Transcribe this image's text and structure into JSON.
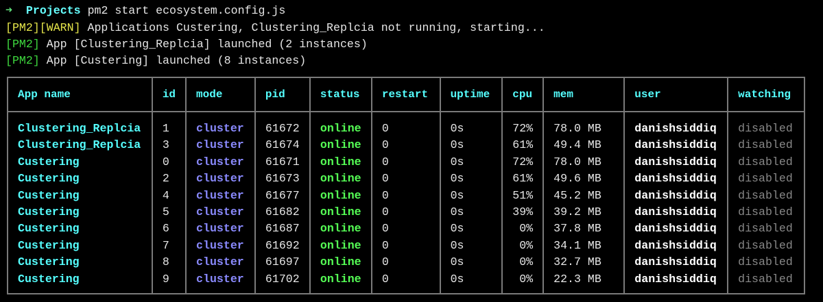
{
  "prompt": {
    "arrow": "➜",
    "dir": "Projects",
    "command": "pm2 start ecosystem.config.js"
  },
  "output": [
    {
      "tag": "[PM2][WARN]",
      "text": " Applications Custering, Clustering_Replcia not running, starting...",
      "color": "#e5e54a"
    },
    {
      "tag": "[PM2]",
      "text": " App [Clustering_Replcia] launched (2 instances)",
      "color": "#3ed83e"
    },
    {
      "tag": "[PM2]",
      "text": " App [Custering] launched (8 instances)",
      "color": "#3ed83e"
    }
  ],
  "table": {
    "headers": [
      "App name",
      "id",
      "mode",
      "pid",
      "status",
      "restart",
      "uptime",
      "cpu",
      "mem",
      "user",
      "watching"
    ],
    "rows": [
      [
        "Clustering_Replcia",
        "1",
        "cluster",
        "61672",
        "online",
        "0",
        "0s",
        "72%",
        "78.0 MB",
        "danishsiddiq",
        "disabled"
      ],
      [
        "Clustering_Replcia",
        "3",
        "cluster",
        "61674",
        "online",
        "0",
        "0s",
        "61%",
        "49.4 MB",
        "danishsiddiq",
        "disabled"
      ],
      [
        "Custering",
        "0",
        "cluster",
        "61671",
        "online",
        "0",
        "0s",
        "72%",
        "78.0 MB",
        "danishsiddiq",
        "disabled"
      ],
      [
        "Custering",
        "2",
        "cluster",
        "61673",
        "online",
        "0",
        "0s",
        "61%",
        "49.6 MB",
        "danishsiddiq",
        "disabled"
      ],
      [
        "Custering",
        "4",
        "cluster",
        "61677",
        "online",
        "0",
        "0s",
        "51%",
        "45.2 MB",
        "danishsiddiq",
        "disabled"
      ],
      [
        "Custering",
        "5",
        "cluster",
        "61682",
        "online",
        "0",
        "0s",
        "39%",
        "39.2 MB",
        "danishsiddiq",
        "disabled"
      ],
      [
        "Custering",
        "6",
        "cluster",
        "61687",
        "online",
        "0",
        "0s",
        "0%",
        "37.8 MB",
        "danishsiddiq",
        "disabled"
      ],
      [
        "Custering",
        "7",
        "cluster",
        "61692",
        "online",
        "0",
        "0s",
        "0%",
        "34.1 MB",
        "danishsiddiq",
        "disabled"
      ],
      [
        "Custering",
        "8",
        "cluster",
        "61697",
        "online",
        "0",
        "0s",
        "0%",
        "32.7 MB",
        "danishsiddiq",
        "disabled"
      ],
      [
        "Custering",
        "9",
        "cluster",
        "61702",
        "online",
        "0",
        "0s",
        "0%",
        "22.3 MB",
        "danishsiddiq",
        "disabled"
      ]
    ]
  }
}
